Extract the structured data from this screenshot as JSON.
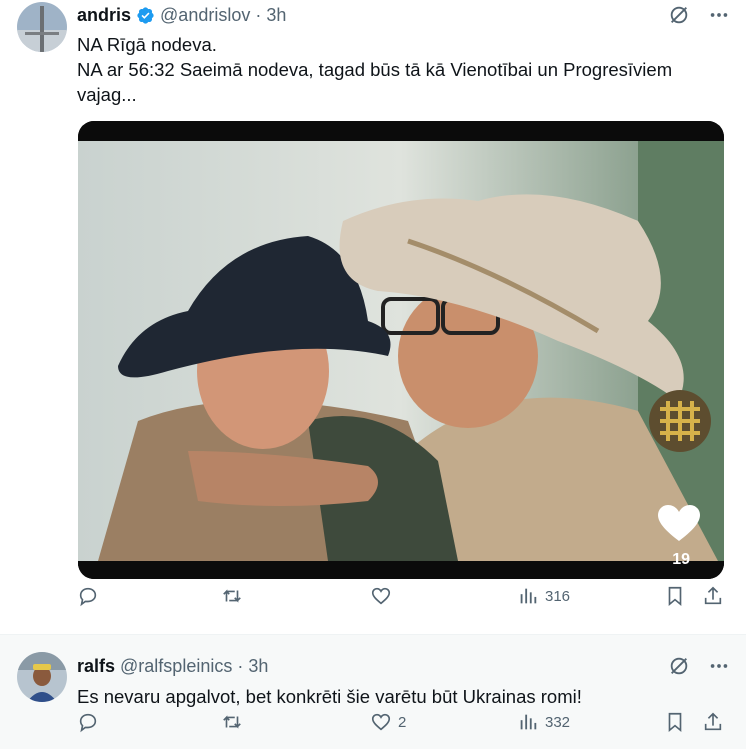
{
  "tweet": {
    "display_name": "andris",
    "handle": "@andrislov",
    "separator": "·",
    "time": "3h",
    "text_line1": "NA Rīgā nodeva.",
    "text_line2": "NA ar 56:32 Saeimā nodeva, tagad būs tā kā Vienotībai un Progresīviem vajag...",
    "media_like_count": "19",
    "actions": {
      "reply_count": "",
      "retweet_count": "",
      "like_count": "",
      "views_count": "316"
    },
    "colors": {
      "verified": "#1d9bf0",
      "text": "#0f1419",
      "muted": "#536471"
    }
  },
  "reply": {
    "display_name": "ralfs",
    "handle": "@ralfspleinics",
    "separator": "·",
    "time": "3h",
    "text": "Es nevaru apgalvot, bet konkrēti šie varētu būt Ukrainas romi!",
    "actions": {
      "reply_count": "",
      "retweet_count": "",
      "like_count": "2",
      "views_count": "332"
    }
  },
  "icons": {
    "verified": "verified-badge-icon",
    "grok": "grok-icon",
    "more": "more-icon",
    "reply": "reply-icon",
    "retweet": "retweet-icon",
    "like": "heart-icon",
    "views": "views-icon",
    "bookmark": "bookmark-icon",
    "share": "share-icon"
  }
}
